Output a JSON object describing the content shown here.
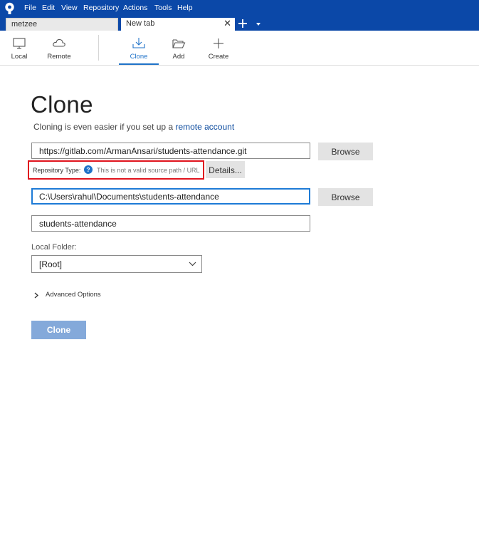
{
  "menu": {
    "items": [
      "File",
      "Edit",
      "View",
      "Repository",
      "Actions",
      "Tools",
      "Help"
    ]
  },
  "tabs": {
    "items": [
      {
        "label": "metzee",
        "active": false
      },
      {
        "label": "New tab",
        "active": true
      }
    ],
    "close_glyph": "✕",
    "add_icon": "plus-icon",
    "dropdown_icon": "caret-down-icon"
  },
  "toolbar": {
    "local": "Local",
    "remote": "Remote",
    "clone": "Clone",
    "add": "Add",
    "create": "Create",
    "active": "Clone"
  },
  "clone_page": {
    "title": "Clone",
    "subtitle_prefix": "Cloning is even easier if you set up a ",
    "subtitle_link": "remote account",
    "source_url": "https://gitlab.com/ArmanAnsari/students-attendance.git",
    "browse_label": "Browse",
    "repo_type_label": "Repository Type:",
    "repo_type_help": "?",
    "repo_type_message": "This is not a valid source path / URL",
    "details_label": "Details...",
    "destination_path": "C:\\Users\\rahul\\Documents\\students-attendance",
    "name": "students-attendance",
    "local_folder_label": "Local Folder:",
    "local_folder_value": "[Root]",
    "advanced_options": "Advanced Options",
    "clone_button": "Clone"
  },
  "colors": {
    "menubar": "#0b48a8",
    "accent": "#1f72c8",
    "error_outline": "#e0141e",
    "disabled_button": "#84a9da",
    "link": "#0b4a9e"
  }
}
